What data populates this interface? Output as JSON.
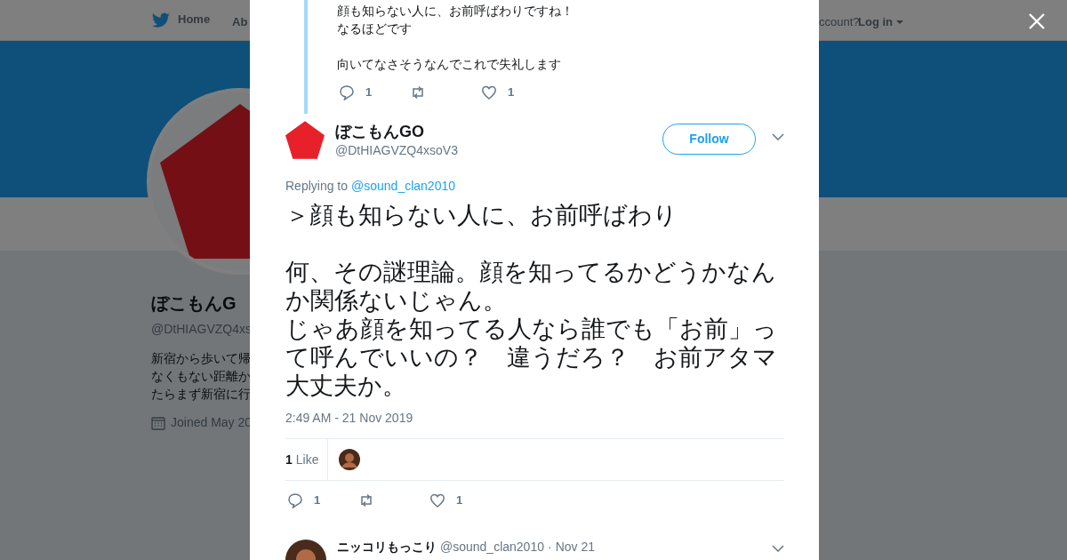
{
  "background_page": {
    "nav": {
      "home_label": "Home",
      "about_label": "Ab",
      "account_prompt": "ccount?",
      "login_label": "Log in"
    },
    "profile": {
      "name": "ぼこもんG",
      "handle": "@DtHIAGVZQ4xs",
      "bio_lines": [
        "新宿から歩いて帰",
        "なくもない距離か",
        "たらまず新宿に行"
      ],
      "joined": "Joined May 20"
    }
  },
  "modal": {
    "parent_tweet": {
      "paragraphs": [
        [
          "顔も知らない人に、お前呼ばわりですね！",
          "なるほどです"
        ],
        [
          "向いてなさそうなんでこれで失礼します"
        ]
      ],
      "actions": [
        {
          "kind": "reply",
          "count": "1"
        },
        {
          "kind": "retweet"
        },
        {
          "kind": "like",
          "count": "1"
        }
      ]
    },
    "tweet": {
      "name": "ぼこもんGO",
      "handle": "@DtHIAGVZQ4xsoV3",
      "follow_label": "Follow",
      "replying_prefix": "Replying to",
      "replying_to": "@sound_clan2010",
      "paragraphs": [
        [
          "＞顔も知らない人に、お前呼ばわり"
        ],
        [
          "何、その謎理論。顔を知ってるかどうかなんか関係ないじゃん。",
          "じゃあ顔を知ってる人なら誰でも「お前」って呼んでいいの？　違うだろ？　お前アタマ大丈夫か。"
        ]
      ],
      "timestamp": "2:49 AM - 21 Nov 2019",
      "likes_count": "1",
      "likes_label": "Like",
      "actions": [
        {
          "kind": "reply",
          "count": "1"
        },
        {
          "kind": "retweet"
        },
        {
          "kind": "like",
          "count": "1"
        }
      ]
    },
    "next_reply": {
      "name": "ニッコリもっこり",
      "handle": "@sound_clan2010",
      "separator": "·",
      "date": "Nov 21"
    }
  }
}
